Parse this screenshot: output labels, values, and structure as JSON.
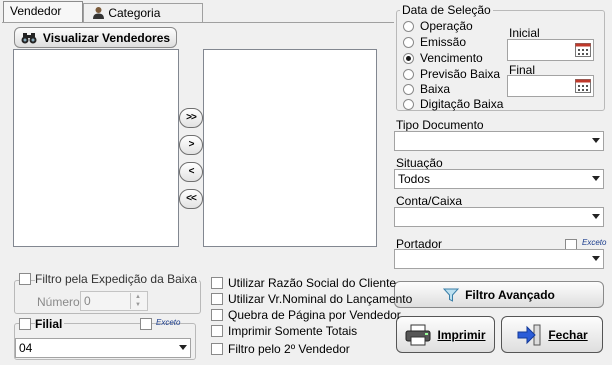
{
  "tabs": [
    "Vendedor",
    "Categoria Cliente"
  ],
  "buttons": {
    "visualizar": "Visualizar Vendedores",
    "move_all_right": ">>",
    "move_right": ">",
    "move_left": "<",
    "move_all_left": "<<",
    "filtro_avancado": "Filtro Avançado",
    "imprimir": "Imprimir",
    "fechar": "Fechar"
  },
  "data_selecao": {
    "title": "Data de Seleção",
    "options": [
      "Operação",
      "Emissão",
      "Vencimento",
      "Previsão Baixa",
      "Baixa",
      "Digitação Baixa"
    ],
    "selected": "Vencimento",
    "inicial_label": "Inicial",
    "final_label": "Final"
  },
  "tipo_documento": {
    "label": "Tipo Documento",
    "value": ""
  },
  "situacao": {
    "label": "Situação",
    "value": "Todos"
  },
  "conta_caixa": {
    "label": "Conta/Caixa",
    "value": ""
  },
  "portador": {
    "label": "Portador",
    "value": "",
    "exceto": "Exceto"
  },
  "filtro_expedicao": {
    "label": "Filtro pela Expedição da Baixa",
    "numero_label": "Número",
    "numero_value": "0"
  },
  "filial": {
    "label": "Filial",
    "exceto": "Exceto",
    "value": "04"
  },
  "options": [
    "Utilizar Razão Social do Cliente",
    "Utilizar Vr.Nominal do Lançamento",
    "Quebra de Página por Vendedor",
    "Imprimir Somente Totais",
    "Filtro pelo 2º Vendedor"
  ]
}
